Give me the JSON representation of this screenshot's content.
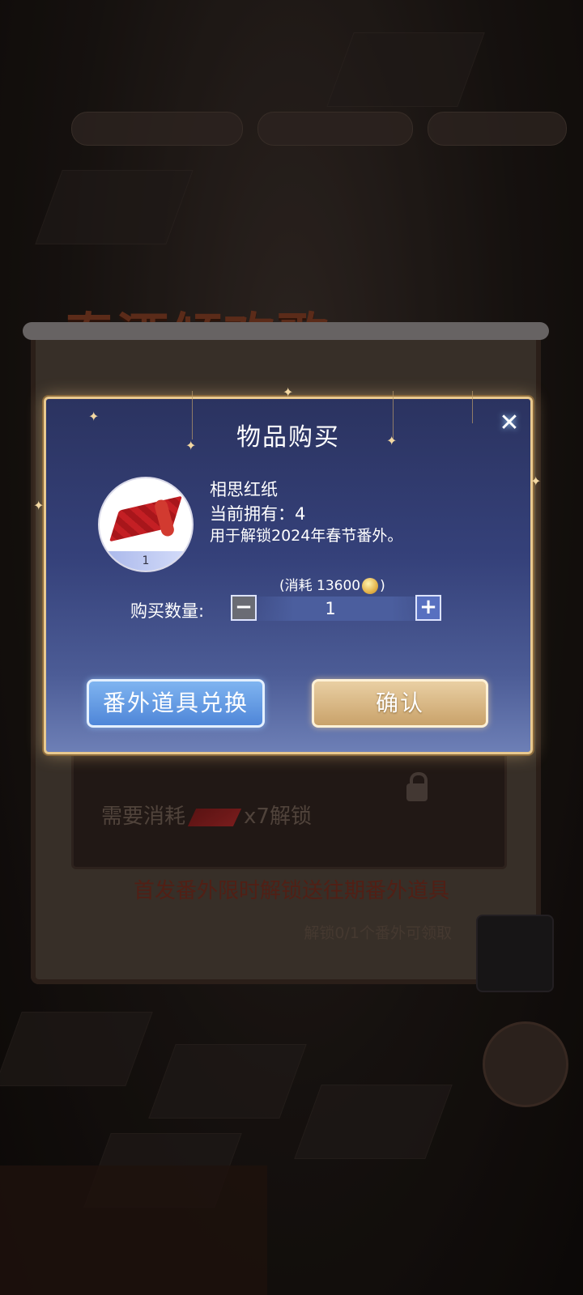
{
  "background": {
    "event_title": "春酒倾欢歌",
    "unlock_requirement": {
      "prefix": "需要消耗",
      "suffix": "x7解锁"
    },
    "promo_text": "首发番外限时解锁送往期番外道具",
    "progress_note": "解锁0/1个番外可领取"
  },
  "modal": {
    "title": "物品购买",
    "close_glyph": "✕",
    "item": {
      "name": "相思红纸",
      "owned_label": "当前拥有：4",
      "description": "用于解锁2024年春节番外。",
      "icon_count": "1",
      "icon": "red-paper-roll-icon"
    },
    "cost": {
      "prefix": "(消耗",
      "amount": "13600",
      "suffix": ")",
      "currency_icon": "gold-coin-icon"
    },
    "quantity": {
      "label": "购买数量:",
      "value": "1",
      "minus": "−",
      "plus": "+"
    },
    "buttons": {
      "exchange": "番外道具兑换",
      "confirm": "确认"
    }
  },
  "colors": {
    "modal_top": "#2b3360",
    "modal_bottom": "#6d7fb6",
    "border_gold": "#e9c98e",
    "exchange_blue": "#4f86d8",
    "confirm_gold": "#c9a26a"
  }
}
